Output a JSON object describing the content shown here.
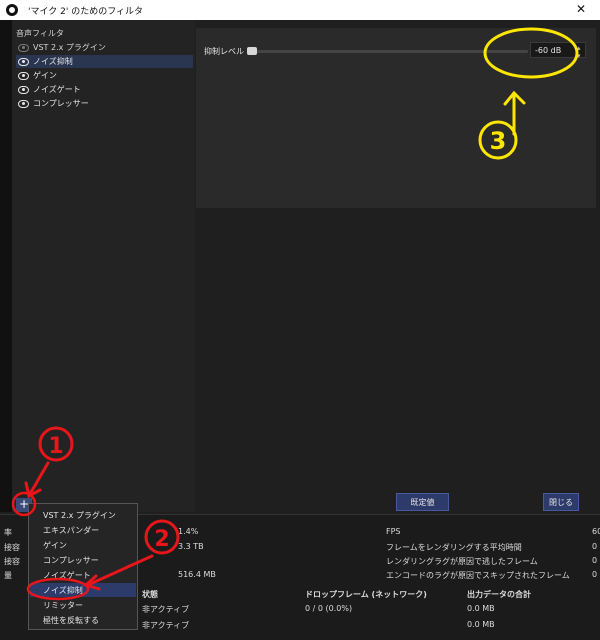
{
  "window": {
    "title": "'マイク 2' のためのフィルタ",
    "close_glyph": "✕"
  },
  "filters": {
    "header": "音声フィルタ",
    "items": [
      {
        "label": "VST 2.x プラグイン",
        "enabled": false
      },
      {
        "label": "ノイズ抑制",
        "enabled": true,
        "selected": true
      },
      {
        "label": "ゲイン",
        "enabled": true
      },
      {
        "label": "ノイズゲート",
        "enabled": true
      },
      {
        "label": "コンプレッサー",
        "enabled": true
      }
    ]
  },
  "properties": {
    "slider_label": "抑制レベル",
    "value_text": "-60 dB",
    "slider_fraction": 0.0
  },
  "buttons": {
    "defaults": "既定値",
    "close": "閉じる",
    "add": "+"
  },
  "menu": {
    "items": [
      "VST 2.x プラグイン",
      "エキスパンダー",
      "ゲイン",
      "コンプレッサー",
      "ノイズゲート",
      "ノイズ抑制",
      "リミッター",
      "極性を反転する"
    ],
    "highlighted_index": 5
  },
  "stats": {
    "left_fragments": [
      "率",
      "接容",
      "接容",
      "量"
    ],
    "left_values": [
      "1.4%",
      "3.3 TB",
      "516.4 MB"
    ],
    "right_labels": [
      "FPS",
      "フレームをレンダリングする平均時間",
      "レンダリングラグが原因で逃したフレーム",
      "エンコードのラグが原因でスキップされたフレーム"
    ],
    "right_values": [
      "60",
      "0",
      "0",
      "0"
    ],
    "table_headers": [
      "状態",
      "ドロップフレーム (ネットワーク)",
      "出力データの合計"
    ],
    "rows": [
      [
        "非アクティブ",
        "0 / 0 (0.0%)",
        "0.0 MB"
      ],
      [
        "非アクティブ",
        "",
        "0.0 MB"
      ]
    ]
  },
  "annotations": {
    "labels": [
      "1",
      "2",
      "3"
    ],
    "color_yellow": "#ffe600",
    "color_red": "#e8161b"
  },
  "colors": {
    "background": "#1f1f1f",
    "panel": "#2a2a2a",
    "selection": "#2d3b6a"
  }
}
